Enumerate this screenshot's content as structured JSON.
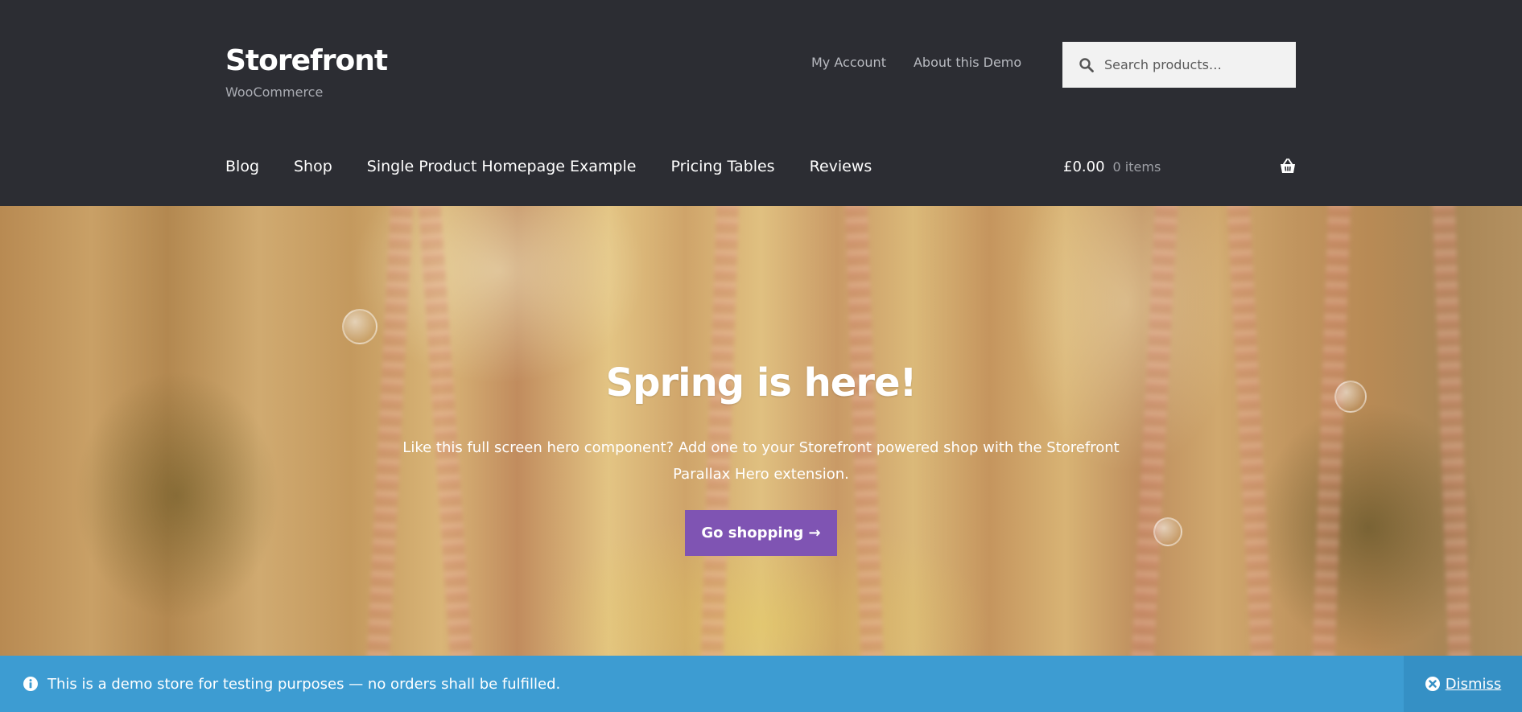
{
  "header": {
    "site_title": "Storefront",
    "tagline": "WooCommerce",
    "secondary_nav": [
      "My Account",
      "About this Demo"
    ],
    "search": {
      "placeholder": "Search products…",
      "icon": "search-icon"
    },
    "primary_nav": [
      "Blog",
      "Shop",
      "Single Product Homepage Example",
      "Pricing Tables",
      "Reviews"
    ],
    "cart": {
      "amount": "£0.00",
      "count": "0 items",
      "icon": "basket-icon"
    }
  },
  "hero": {
    "title": "Spring is here!",
    "text": "Like this full screen hero component? Add one to your Storefront powered shop with the Storefront Parallax Hero extension.",
    "button_label": "Go shopping →"
  },
  "notice": {
    "text": "This is a demo store for testing purposes — no orders shall be fulfilled.",
    "dismiss_label": "Dismiss",
    "icon": "info-icon"
  },
  "colors": {
    "header_bg": "#2c2d33",
    "accent_button": "#7f54b3",
    "notice_bg": "#3d9cd2",
    "dismiss_bg": "#3590c5"
  }
}
